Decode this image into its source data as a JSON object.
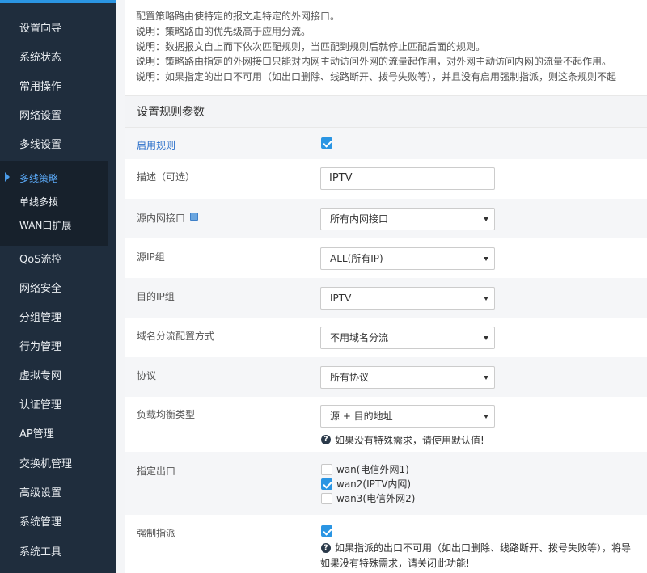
{
  "sidebar": {
    "items": [
      {
        "label": "设置向导"
      },
      {
        "label": "系统状态"
      },
      {
        "label": "常用操作"
      },
      {
        "label": "网络设置"
      },
      {
        "label": "多线设置"
      },
      {
        "label": "QoS流控"
      },
      {
        "label": "网络安全"
      },
      {
        "label": "分组管理"
      },
      {
        "label": "行为管理"
      },
      {
        "label": "虚拟专网"
      },
      {
        "label": "认证管理"
      },
      {
        "label": "AP管理"
      },
      {
        "label": "交换机管理"
      },
      {
        "label": "高级设置"
      },
      {
        "label": "系统管理"
      },
      {
        "label": "系统工具"
      }
    ],
    "submenu": [
      {
        "label": "多线策略",
        "active": true
      },
      {
        "label": "单线多拨"
      },
      {
        "label": "WAN口扩展"
      }
    ]
  },
  "notes": [
    "配置策略路由使特定的报文走特定的外网接口。",
    "说明：策略路由的优先级高于应用分流。",
    "说明：数据报文自上而下依次匹配规则，当匹配到规则后就停止匹配后面的规则。",
    "说明：策略路由指定的外网接口只能对内网主动访问外网的流量起作用，对外网主动访问内网的流量不起作用。",
    "说明：如果指定的出口不可用（如出口删除、线路断开、拨号失败等），并且没有启用强制指派，则这条规则不起"
  ],
  "form": {
    "section_title": "设置规则参数",
    "enable": {
      "label": "启用规则",
      "checked": true
    },
    "description": {
      "label": "描述（可选）",
      "value": "IPTV"
    },
    "src_iface": {
      "label": "源内网接口",
      "value": "所有内网接口"
    },
    "src_ip": {
      "label": "源IP组",
      "value": "ALL(所有IP)"
    },
    "dst_ip": {
      "label": "目的IP组",
      "value": "IPTV"
    },
    "domain_mode": {
      "label": "域名分流配置方式",
      "value": "不用域名分流"
    },
    "protocol": {
      "label": "协议",
      "value": "所有协议"
    },
    "lb_type": {
      "label": "负载均衡类型",
      "value": "源 + 目的地址",
      "help": "如果没有特殊需求，请使用默认值!"
    },
    "egress": {
      "label": "指定出口",
      "options": [
        {
          "label": "wan(电信外网1)",
          "checked": false
        },
        {
          "label": "wan2(IPTV内网)",
          "checked": true
        },
        {
          "label": "wan3(电信外网2)",
          "checked": false
        }
      ]
    },
    "force": {
      "label": "强制指派",
      "checked": true,
      "help_line1": "如果指派的出口不可用（如出口删除、线路断开、拨号失败等），将导",
      "help_line2": "如果没有特殊需求，请关闭此功能!"
    }
  },
  "colors": {
    "sidebar_bg": "#1f2d3d",
    "accent": "#2a95e3",
    "active_text": "#5aa8f5"
  }
}
